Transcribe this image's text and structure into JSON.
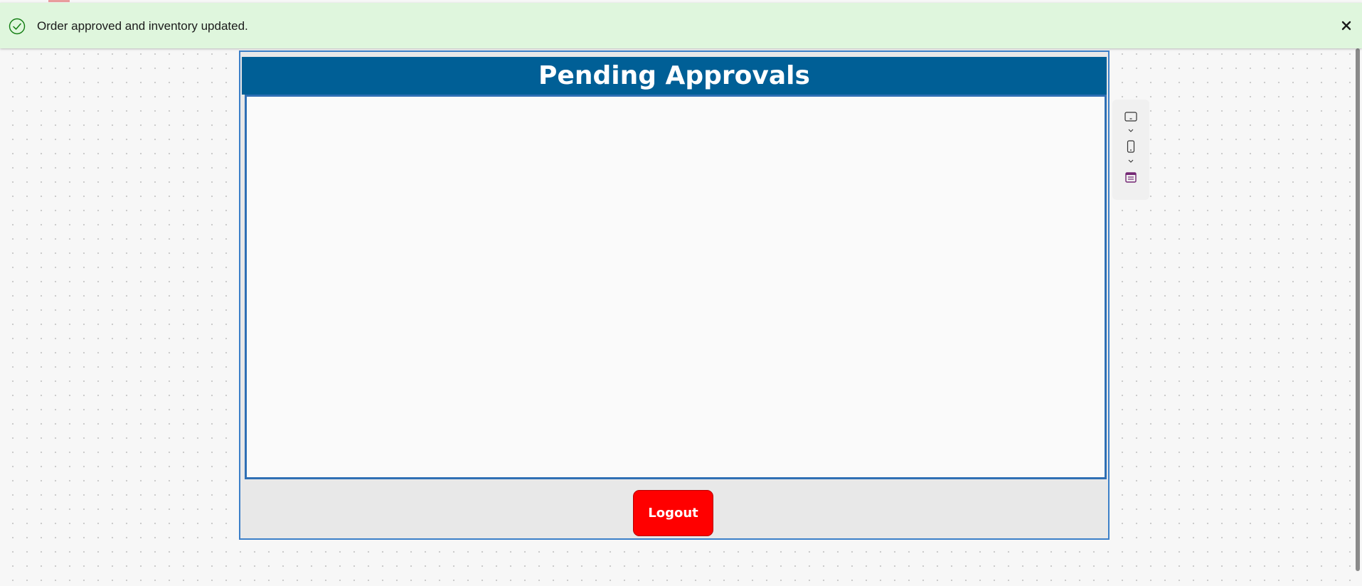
{
  "notification": {
    "message": "Order approved and inventory updated.",
    "icon": "success-check-icon",
    "close_icon": "close-icon",
    "color": "#dff6dd"
  },
  "screen": {
    "title": "Pending Approvals",
    "title_color": "#005f96",
    "logout_label": "Logout",
    "logout_color": "#ff0000"
  },
  "device_toolbar": {
    "items": [
      {
        "icon": "tablet-landscape-icon"
      },
      {
        "icon": "chevron-down-icon"
      },
      {
        "icon": "phone-icon"
      },
      {
        "icon": "chevron-down-icon"
      },
      {
        "icon": "calendar-app-icon"
      }
    ]
  }
}
